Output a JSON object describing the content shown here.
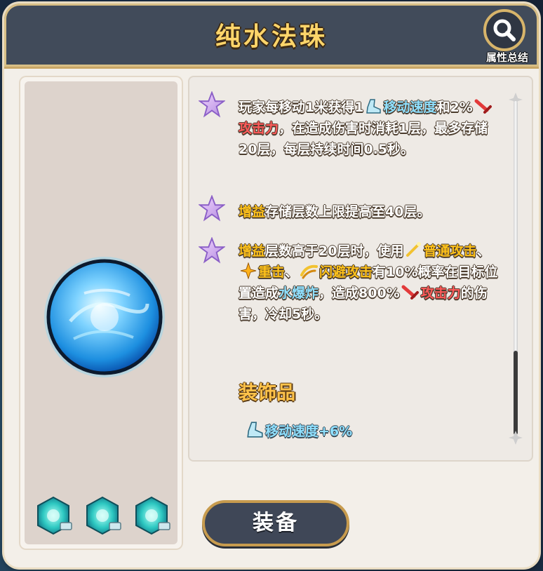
{
  "header": {
    "title": "纯水法珠",
    "summary_label": "属性总结"
  },
  "item": {
    "icon": "blue-water-orb",
    "gem_slots": [
      "aqua-gem",
      "aqua-gem",
      "aqua-gem"
    ]
  },
  "effects": [
    {
      "parts": [
        {
          "t": "玩家每移动1米获得1",
          "c": ""
        },
        {
          "icon": "boot-icon"
        },
        {
          "t": "移动速度",
          "c": "blue"
        },
        {
          "t": "和2%",
          "c": ""
        },
        {
          "icon": "sword-icon"
        },
        {
          "t": "攻击力",
          "c": "red"
        },
        {
          "t": "，在造成伤害时消耗1层，最多存储20层，每层持续时间0.5秒。",
          "c": ""
        }
      ]
    },
    {
      "parts": [
        {
          "t": "增益",
          "c": "orange"
        },
        {
          "t": "存储层数上限提高至40层。",
          "c": ""
        }
      ]
    },
    {
      "parts": [
        {
          "t": "增益",
          "c": "orange"
        },
        {
          "t": "层数高于20层时，使用",
          "c": ""
        },
        {
          "icon": "sparkle-sword-icon"
        },
        {
          "t": "普通攻击",
          "c": "orange"
        },
        {
          "t": "、",
          "c": ""
        },
        {
          "icon": "heavy-strike-icon"
        },
        {
          "t": "重击",
          "c": "orange"
        },
        {
          "t": "、",
          "c": ""
        },
        {
          "icon": "dodge-icon"
        },
        {
          "t": "闪避攻击",
          "c": "orange"
        },
        {
          "t": "有10%概率在目标位置造成",
          "c": ""
        },
        {
          "t": "水爆炸",
          "c": "blue"
        },
        {
          "t": "，造成800%",
          "c": ""
        },
        {
          "icon": "sword-icon"
        },
        {
          "t": "攻击力",
          "c": "red"
        },
        {
          "t": "的伤害，冷却5秒。",
          "c": ""
        }
      ]
    }
  ],
  "decoration": {
    "title": "装饰品",
    "stat_icon": "boot-icon",
    "stat": "移动速度+6%"
  },
  "actions": {
    "equip_label": "装备"
  },
  "colors": {
    "title_bar": "#414b5a",
    "gold": "#ffd56a",
    "keyword_blue": "#8fe0ff",
    "keyword_red": "#ff5a5a",
    "keyword_orange": "#ffc21a"
  }
}
